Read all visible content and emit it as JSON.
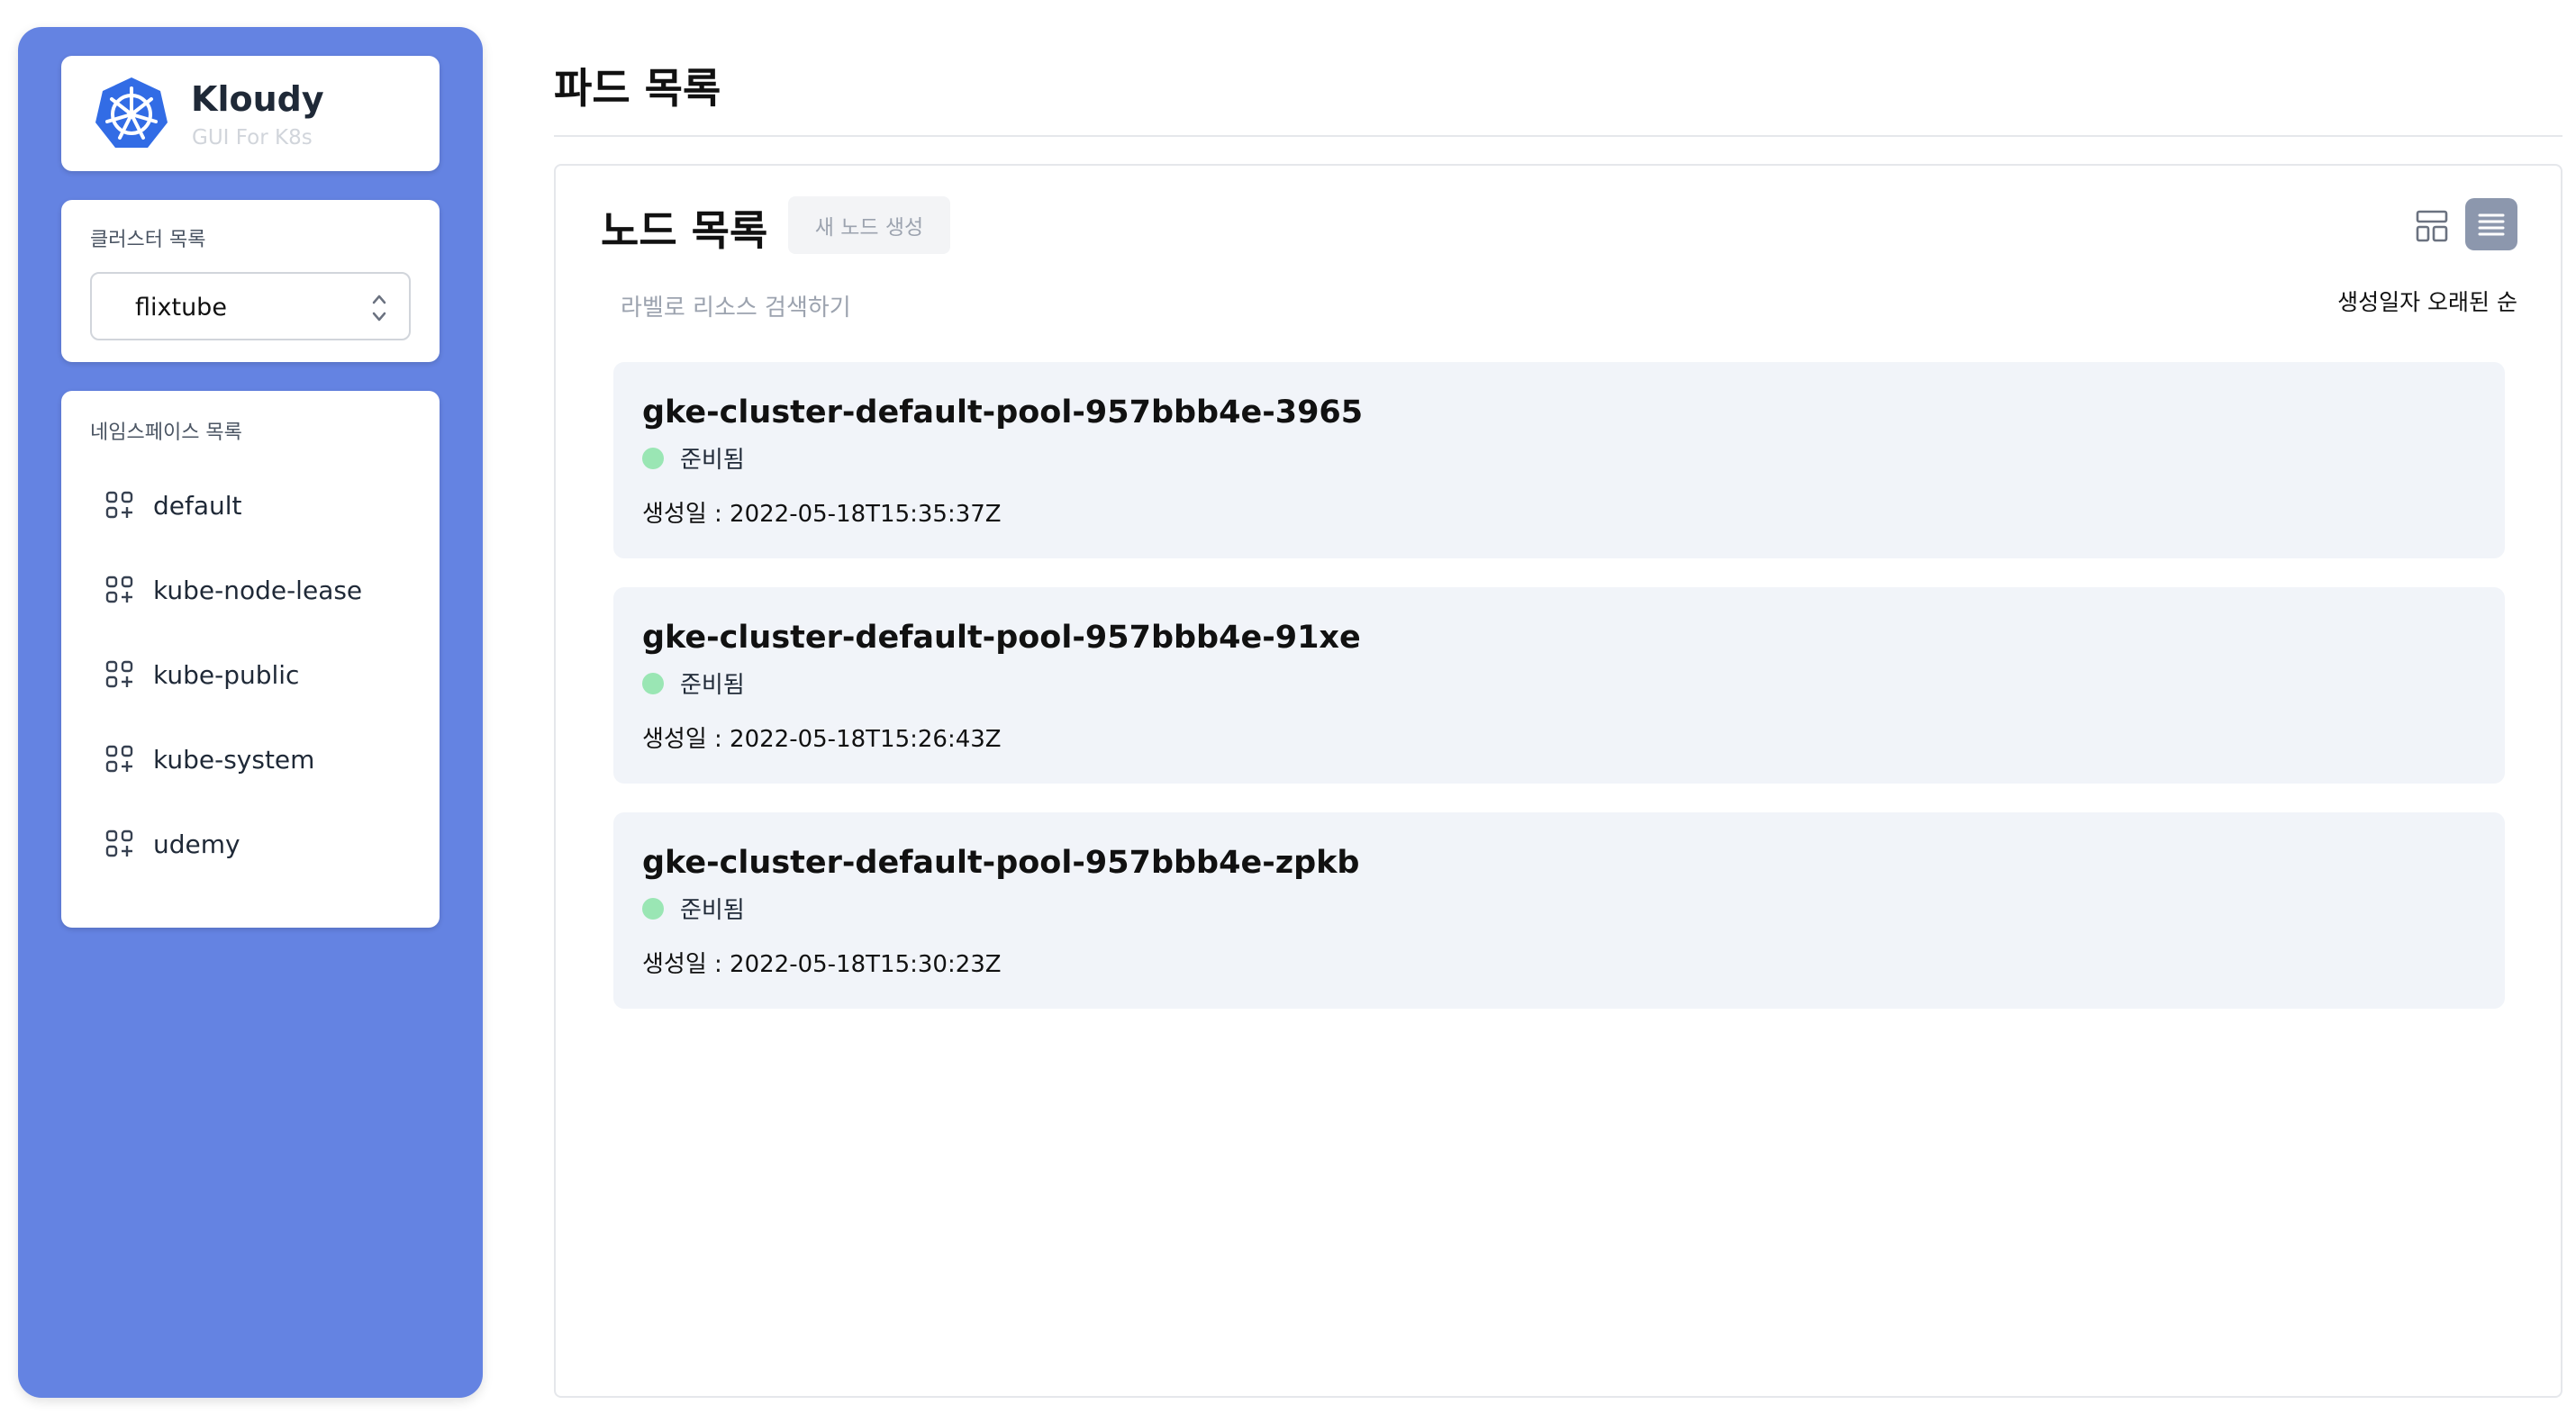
{
  "app": {
    "title": "Kloudy",
    "subtitle": "GUI For K8s"
  },
  "sidebar": {
    "cluster_label": "클러스터 목록",
    "cluster_selected": "flixtube",
    "namespace_label": "네임스페이스 목록",
    "namespaces": [
      {
        "label": "default"
      },
      {
        "label": "kube-node-lease"
      },
      {
        "label": "kube-public"
      },
      {
        "label": "kube-system"
      },
      {
        "label": "udemy"
      }
    ]
  },
  "main": {
    "page_title": "파드 목록",
    "section_title": "노드 목록",
    "new_button": "새 노드 생성",
    "search_placeholder": "라벨로 리소스 검색하기",
    "sort_label": "생성일자 오래된 순",
    "nodes": [
      {
        "name": "gke-cluster-default-pool-957bbb4e-3965",
        "status": "준비됨",
        "created": "생성일 : 2022-05-18T15:35:37Z"
      },
      {
        "name": "gke-cluster-default-pool-957bbb4e-91xe",
        "status": "준비됨",
        "created": "생성일 : 2022-05-18T15:26:43Z"
      },
      {
        "name": "gke-cluster-default-pool-957bbb4e-zpkb",
        "status": "준비됨",
        "created": "생성일 : 2022-05-18T15:30:23Z"
      }
    ]
  },
  "colors": {
    "sidebar": "#6483e2",
    "logo_blue": "#326ce5",
    "status_ready": "#9ae6b4",
    "card_bg": "#f1f4f9"
  },
  "icons": {
    "logo": "kubernetes-helm-icon",
    "namespace": "grid-plus-icon",
    "select": "chevron-up-down-icon",
    "view_grid": "layout-grid-icon",
    "view_list": "list-icon"
  }
}
